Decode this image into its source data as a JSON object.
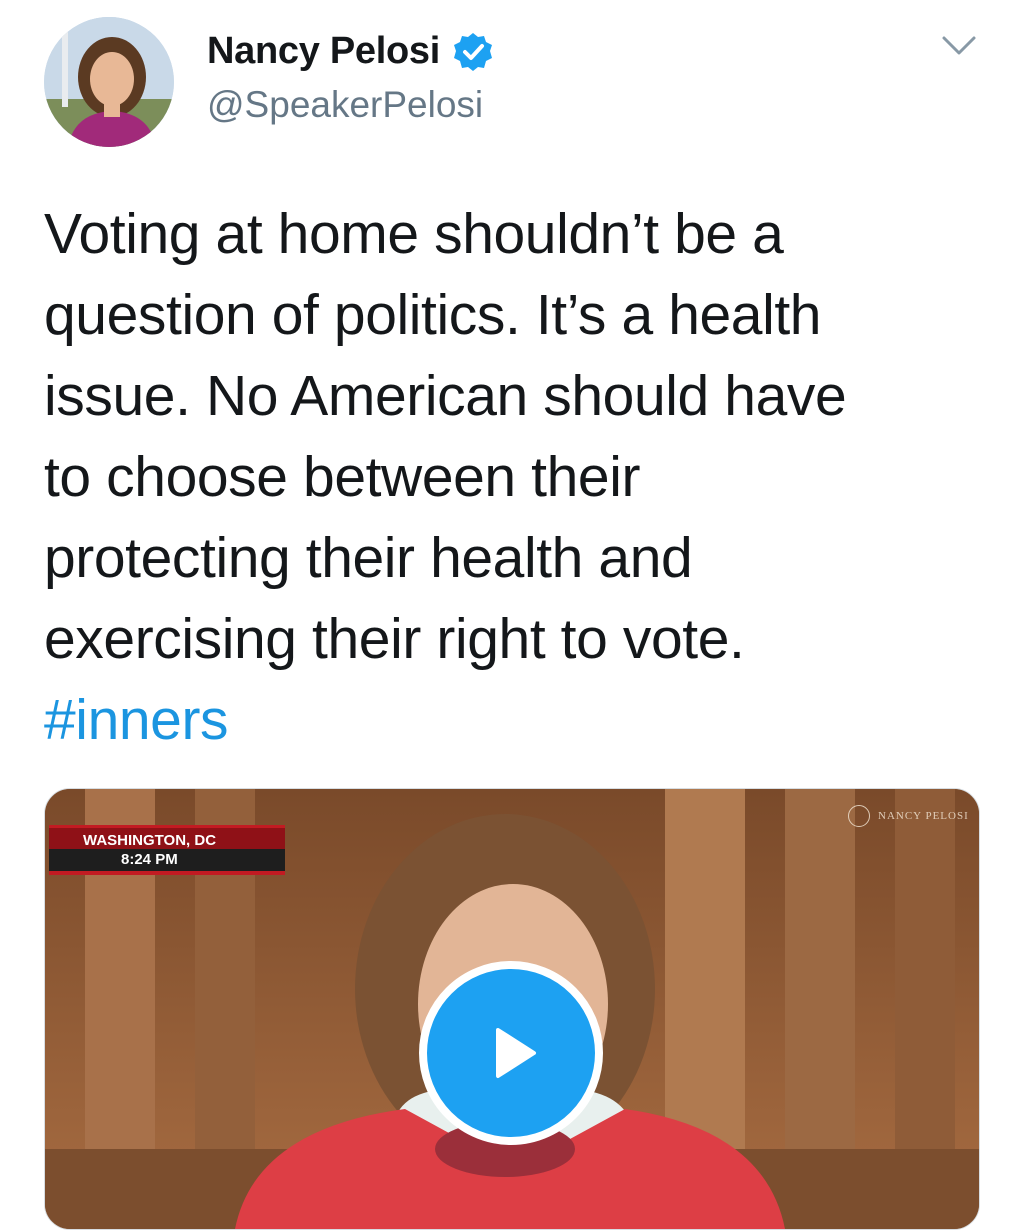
{
  "author": {
    "display_name": "Nancy Pelosi",
    "handle": "@SpeakerPelosi",
    "verified": true
  },
  "icons": {
    "verified": "verified-badge-icon",
    "menu": "chevron-down-icon",
    "play": "play-icon"
  },
  "tweet": {
    "lines": [
      "Voting at home shouldn’t be a",
      "question of politics. It’s a health",
      "issue. No American should have",
      "to choose between their",
      "protecting their health and",
      "exercising their right to vote."
    ],
    "hashtag": "#inners"
  },
  "media": {
    "type": "video",
    "location_label": "WASHINGTON, DC",
    "time_label": "8:24 PM",
    "watermark": "NANCY PELOSI"
  },
  "colors": {
    "accent": "#1da1f2",
    "hashtag": "#1b95e0",
    "text": "#14171a",
    "secondary": "#657786",
    "lower_third_red": "#8f1117"
  }
}
